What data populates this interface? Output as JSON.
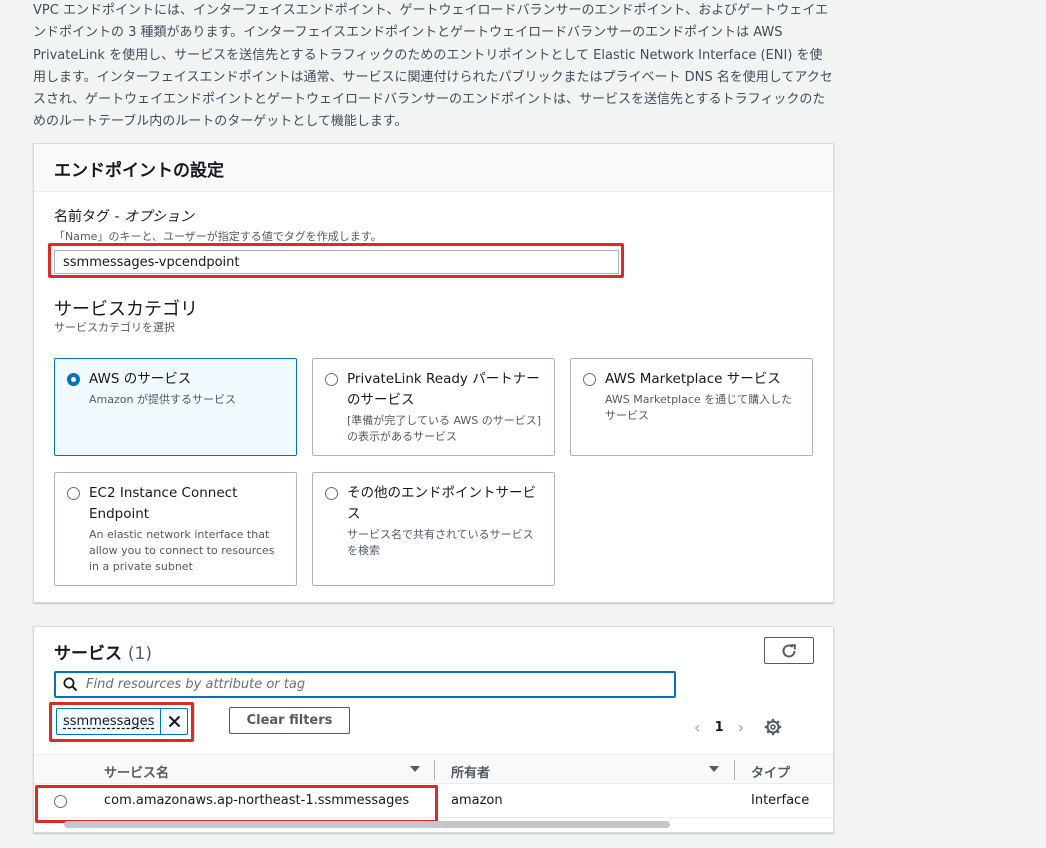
{
  "intro_text": "VPC エンドポイントには、インターフェイスエンドポイント、ゲートウェイロードバランサーのエンドポイント、およびゲートウェイエンドポイントの 3 種類があります。インターフェイスエンドポイントとゲートウェイロードバランサーのエンドポイントは AWS PrivateLink を使用し、サービスを送信先とするトラフィックのためのエントリポイントとして Elastic Network Interface (ENI) を使用します。インターフェイスエンドポイントは通常、サービスに関連付けられたパブリックまたはプライベート DNS 名を使用してアクセスされ、ゲートウェイエンドポイントとゲートウェイロードバランサーのエンドポイントは、サービスを送信先とするトラフィックのためのルートテーブル内のルートのターゲットとして機能します。",
  "settings": {
    "title": "エンドポイントの設定",
    "name_tag_label": "名前タグ - ",
    "name_tag_optional": "オプション",
    "name_tag_desc": "「Name」のキーと、ユーザーが指定する値でタグを作成します。",
    "name_tag_value": "ssmmessages-vpcendpoint",
    "category_title": "サービスカテゴリ",
    "category_desc": "サービスカテゴリを選択",
    "tiles": [
      {
        "title": "AWS のサービス",
        "desc": "Amazon が提供するサービス",
        "selected": true
      },
      {
        "title": "PrivateLink Ready パートナーのサービス",
        "desc": "[準備が完了している AWS のサービス] の表示があるサービス",
        "selected": false
      },
      {
        "title": "AWS Marketplace サービス",
        "desc": "AWS Marketplace を通じて購入したサービス",
        "selected": false
      },
      {
        "title": "EC2 Instance Connect Endpoint",
        "desc": "An elastic network interface that allow you to connect to resources in a private subnet",
        "selected": false
      },
      {
        "title": "その他のエンドポイントサービス",
        "desc": "サービス名で共有されているサービスを検索",
        "selected": false
      }
    ]
  },
  "services": {
    "title": "サービス",
    "count": "(1)",
    "search_placeholder": "Find resources by attribute or tag",
    "filter_token": "ssmmessages",
    "clear_filters": "Clear filters",
    "page": "1",
    "columns": [
      "サービス名",
      "所有者",
      "タイプ"
    ],
    "rows": [
      {
        "name": "com.amazonaws.ap-northeast-1.ssmmessages",
        "owner": "amazon",
        "type": "Interface"
      }
    ]
  },
  "colors": {
    "accent": "#0073bb",
    "highlight": "#d92c26"
  }
}
